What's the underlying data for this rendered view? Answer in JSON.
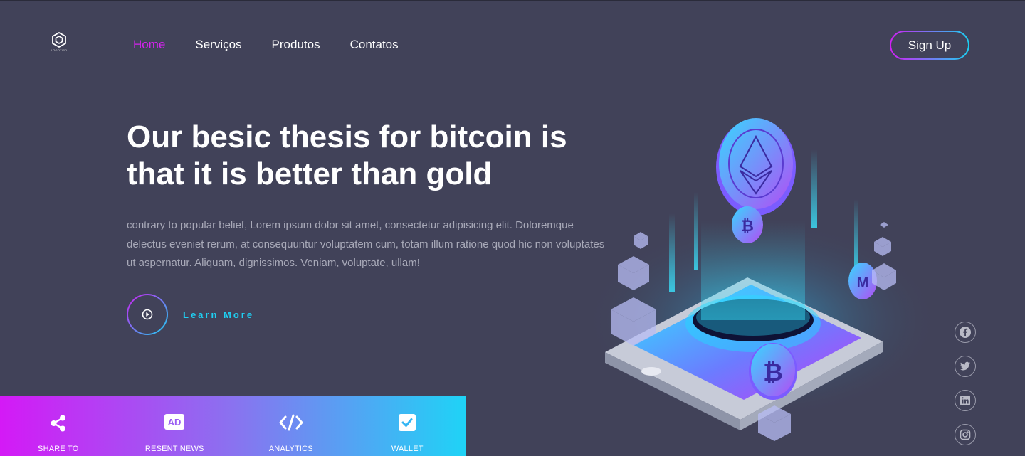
{
  "logo": {
    "text": "LOGOTIPO",
    "icon": "hexagon-logo-icon"
  },
  "nav": {
    "items": [
      {
        "label": "Home",
        "active": true
      },
      {
        "label": "Serviços",
        "active": false
      },
      {
        "label": "Produtos",
        "active": false
      },
      {
        "label": "Contatos",
        "active": false
      }
    ]
  },
  "header": {
    "signup_label": "Sign Up"
  },
  "hero": {
    "title": "Our besic thesis for bitcoin is that it is better than gold",
    "body": "contrary to popular belief, Lorem ipsum dolor sit amet, consectetur adipisicing elit. Doloremque delectus eveniet rerum, at consequuntur voluptatem cum, totam illum ratione quod hic non voluptates ut aspernatur. Aliquam, dignissimos. Veniam, voluptate, ullam!",
    "cta_label": "Learn More"
  },
  "features": [
    {
      "label": "SHARE TO",
      "icon": "share-icon"
    },
    {
      "label": "RESENT NEWS",
      "icon": "ad-icon"
    },
    {
      "label": "ANALYTICS",
      "icon": "code-icon"
    },
    {
      "label": "WALLET",
      "icon": "checkbox-icon"
    }
  ],
  "socials": [
    {
      "icon": "facebook-icon"
    },
    {
      "icon": "twitter-icon"
    },
    {
      "icon": "linkedin-icon"
    },
    {
      "icon": "instagram-icon"
    }
  ],
  "colors": {
    "background": "#414259",
    "accent_pink": "#d21ff5",
    "accent_cyan": "#1ad1f2",
    "body_text": "#a8a9b8"
  }
}
